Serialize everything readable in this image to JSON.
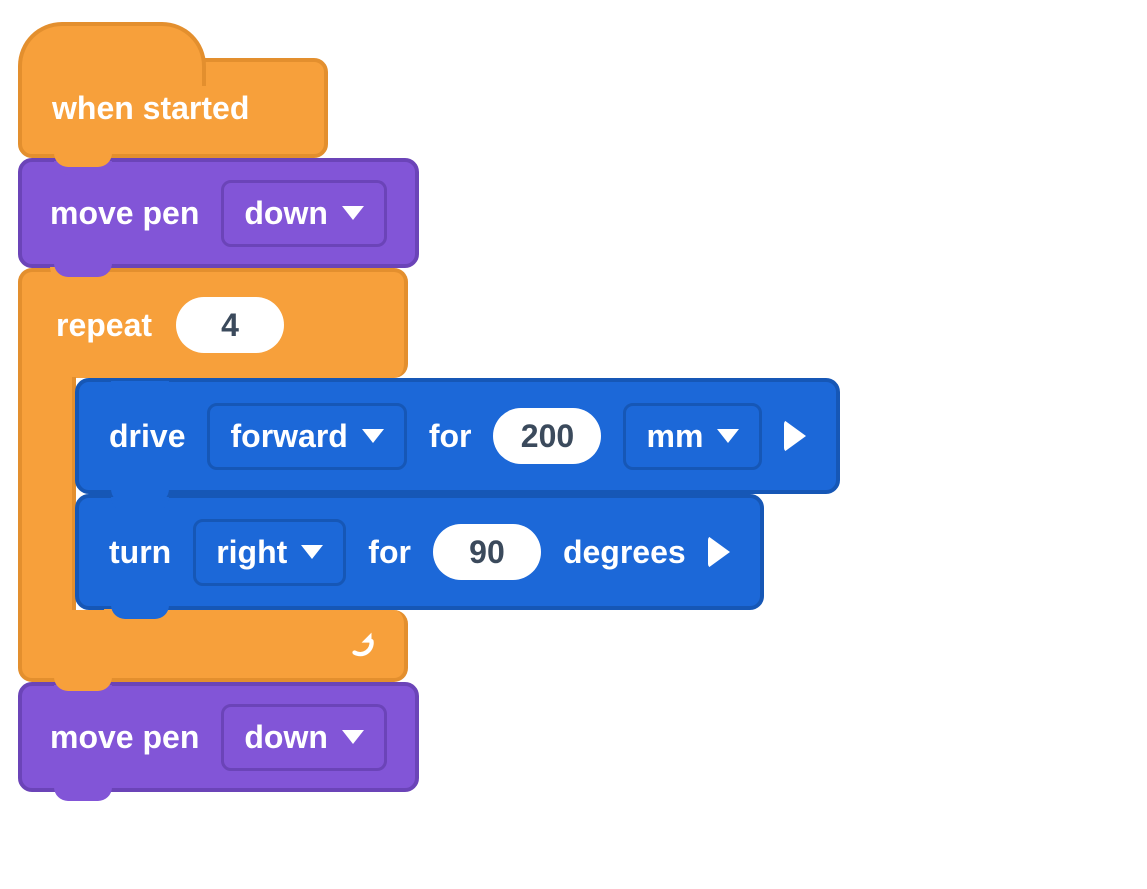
{
  "hat": {
    "label": "when started"
  },
  "pen1": {
    "label": "move pen",
    "direction": "down"
  },
  "repeat": {
    "label": "repeat",
    "count": "4"
  },
  "drive": {
    "label": "drive",
    "direction": "forward",
    "for": "for",
    "distance": "200",
    "unit": "mm"
  },
  "turn": {
    "label": "turn",
    "direction": "right",
    "for": "for",
    "angle": "90",
    "unit": "degrees"
  },
  "pen2": {
    "label": "move pen",
    "direction": "down"
  }
}
